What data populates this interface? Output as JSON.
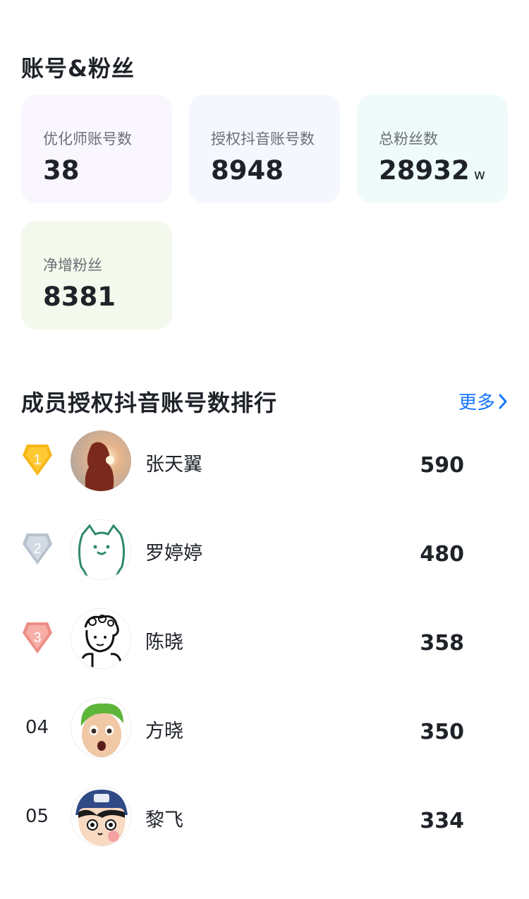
{
  "accounts_section": {
    "title": "账号&粉丝",
    "cards": [
      {
        "label": "优化师账号数",
        "value": "38",
        "unit": ""
      },
      {
        "label": "授权抖音账号数",
        "value": "8948",
        "unit": ""
      },
      {
        "label": "总粉丝数",
        "value": "28932",
        "unit": "w"
      },
      {
        "label": "净增粉丝",
        "value": "8381",
        "unit": ""
      }
    ]
  },
  "ranking_section": {
    "title": "成员授权抖音账号数排行",
    "more_label": "更多",
    "rows": [
      {
        "rank": "1",
        "name": "张天翼",
        "count": "590",
        "medal": "gold-medal-icon"
      },
      {
        "rank": "2",
        "name": "罗婷婷",
        "count": "480",
        "medal": "silver-medal-icon"
      },
      {
        "rank": "3",
        "name": "陈晓",
        "count": "358",
        "medal": "bronze-medal-icon"
      },
      {
        "rank": "04",
        "name": "方晓",
        "count": "350"
      },
      {
        "rank": "05",
        "name": "黎飞",
        "count": "334"
      }
    ]
  },
  "colors": {
    "accent": "#1677ff",
    "gold": "#f6b717",
    "silver": "#c3ccd6",
    "bronze": "#ef9c93"
  }
}
